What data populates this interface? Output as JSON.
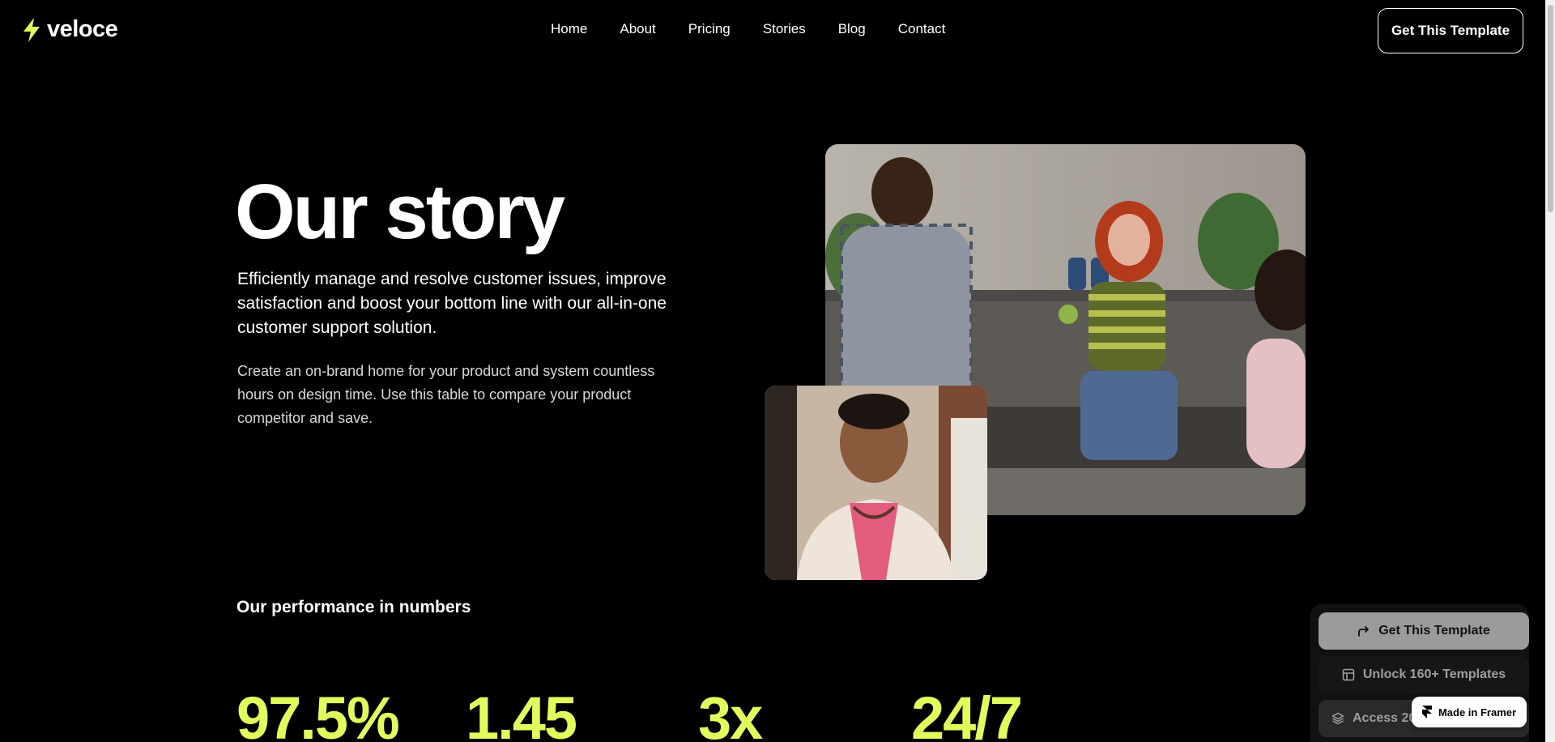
{
  "brand": {
    "name": "veloce",
    "accent": "#e3fb5b"
  },
  "nav": {
    "items": [
      {
        "label": "Home"
      },
      {
        "label": "About"
      },
      {
        "label": "Pricing"
      },
      {
        "label": "Stories"
      },
      {
        "label": "Blog"
      },
      {
        "label": "Contact"
      }
    ],
    "cta_label": "Get This Template"
  },
  "hero": {
    "title": "Our story",
    "lead": "Efficiently manage and resolve customer issues, improve satisfaction and boost your bottom line with our all-in-one customer support solution.",
    "body": "Create an on-brand home for your product and system countless hours on design time. Use this table to compare your product competitor and save."
  },
  "performance": {
    "heading": "Our performance in numbers",
    "stats": [
      {
        "value": "97.5%"
      },
      {
        "value": "1.45"
      },
      {
        "value": "3x"
      },
      {
        "value": "24/7"
      }
    ]
  },
  "panel": {
    "get_template": "Get This Template",
    "unlock": "Unlock 160+ Templates",
    "access": "Access 20",
    "framer_badge": "Made in Framer"
  }
}
